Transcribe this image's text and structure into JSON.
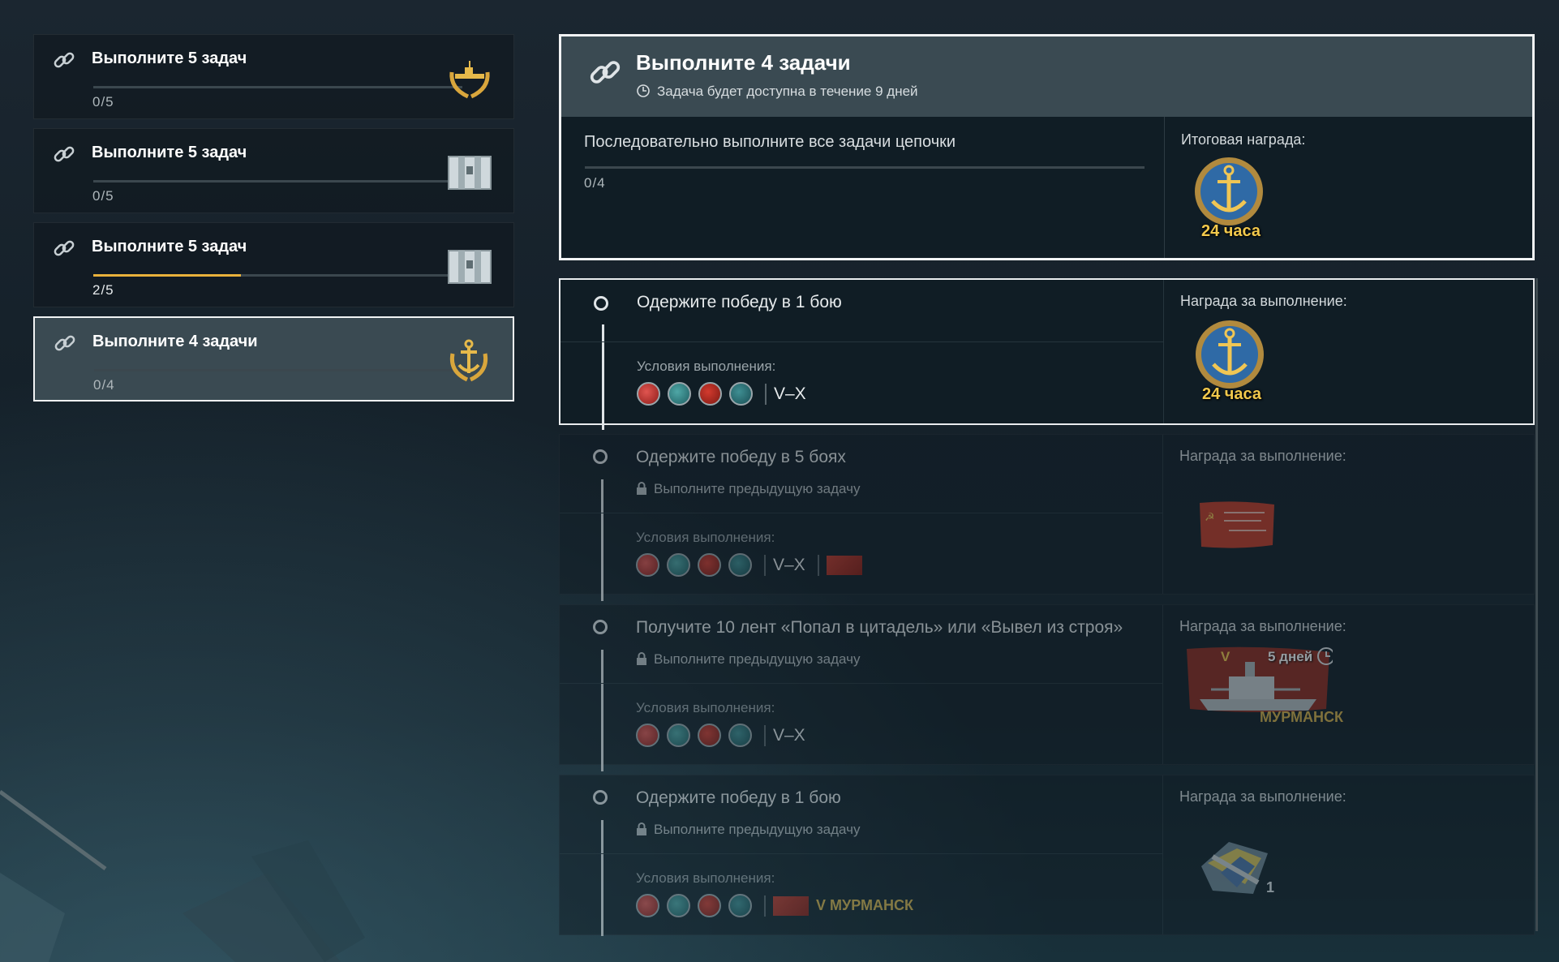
{
  "chains": [
    {
      "title": "Выполните 5 задач",
      "count": "0/5",
      "progress": 0,
      "reward_icon": "laurel-ship-icon"
    },
    {
      "title": "Выполните 5 задач",
      "count": "0/5",
      "progress": 0,
      "reward_icon": "container-icon"
    },
    {
      "title": "Выполните 5 задач",
      "count": "2/5",
      "progress": 0.4,
      "reward_icon": "container-icon"
    },
    {
      "title": "Выполните 4 задачи",
      "count": "0/4",
      "progress": 0,
      "reward_icon": "anchor-laurel-icon",
      "selected": true
    }
  ],
  "main": {
    "title": "Выполните 4 задачи",
    "availability": "Задача будет доступна в течение 9 дней",
    "description": "Последовательно выполните все задачи цепочки",
    "count": "0/4",
    "final_reward_label": "Итоговая награда:",
    "final_reward_text": "24 часа"
  },
  "tasks": [
    {
      "title": "Одержите победу в 1 бою",
      "conditions_label": "Условия выполнения:",
      "tier": "V–X",
      "reward_label": "Награда за выполнение:",
      "reward_text": "24 часа"
    },
    {
      "title": "Одержите победу в 5 боях",
      "lock_text": "Выполните предыдущую задачу",
      "conditions_label": "Условия выполнения:",
      "tier": "V–X",
      "reward_label": "Награда за выполнение:"
    },
    {
      "title": "Получите 10 лент «Попал в цитадель» или «Вывел из строя»",
      "lock_text": "Выполните предыдущую задачу",
      "conditions_label": "Условия выполнения:",
      "tier": "V–X",
      "reward_label": "Награда за выполнение:",
      "reward_ship_tier": "V",
      "reward_duration": "5 дней",
      "reward_ship_name": "МУРМАНСК"
    },
    {
      "title": "Одержите победу в 1 бою",
      "lock_text": "Выполните предыдущую задачу",
      "conditions_label": "Условия выполнения:",
      "ship_tag": "V МУРМАНСК",
      "reward_label": "Награда за выполнение:",
      "reward_count": "1"
    }
  ],
  "colors": {
    "accent": "#e9b13b",
    "gold_text": "#f2c94c",
    "selected_bg": "#3a4a52"
  }
}
